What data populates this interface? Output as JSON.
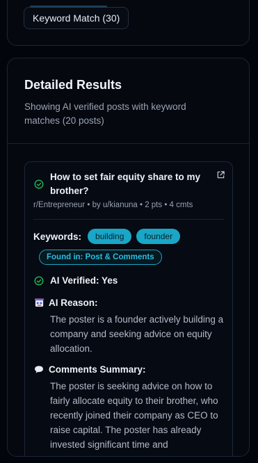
{
  "filter": {
    "keyword_match_label": "Keyword Match (30)"
  },
  "results": {
    "title": "Detailed Results",
    "subtitle": "Showing AI verified posts with keyword matches (20 posts)"
  },
  "post": {
    "title": "How to set fair equity share to my brother?",
    "meta": "r/Entrepreneur • by u/kianuna • 2 pts • 4 cmts",
    "keywords_label": "Keywords:",
    "keywords": [
      "building",
      "founder"
    ],
    "found_in": "Found in: Post & Comments",
    "ai_verified": "AI Verified: Yes",
    "ai_reason_label": "AI Reason:",
    "ai_reason": "The poster is a founder actively building a company and seeking advice on equity allocation.",
    "comments_summary_label": "Comments Summary:",
    "comments_summary": "The poster is seeking advice on how to fairly allocate equity to their brother, who recently joined their company as CEO to raise capital. The poster has already invested significant time and"
  },
  "icons": {
    "verified": "check-circle-icon",
    "external": "external-link-icon",
    "ai_reason": "robot-icon",
    "comments": "speech-bubble-icon"
  },
  "colors": {
    "background": "#03050d",
    "card": "#05080f",
    "accent": "#1aa6c6",
    "success": "#22c55e"
  }
}
